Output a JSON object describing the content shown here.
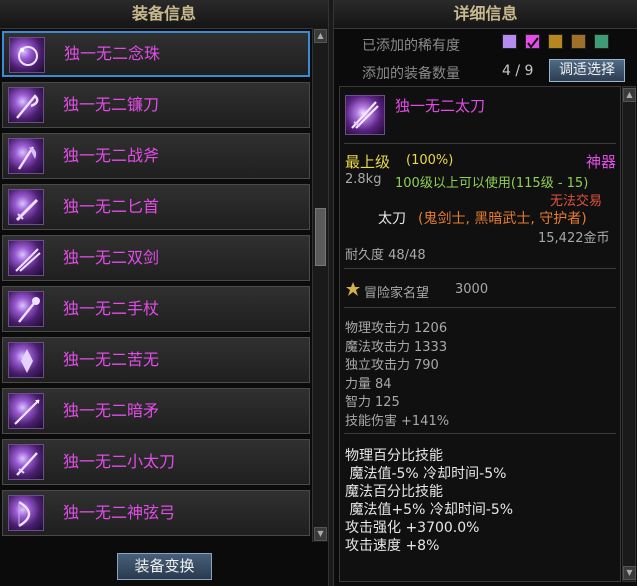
{
  "left_panel": {
    "title": "装备信息",
    "items": [
      {
        "label": "独一无二念珠"
      },
      {
        "label": "独一无二镰刀"
      },
      {
        "label": "独一无二战斧"
      },
      {
        "label": "独一无二匕首"
      },
      {
        "label": "独一无二双剑"
      },
      {
        "label": "独一无二手杖"
      },
      {
        "label": "独一无二苦无"
      },
      {
        "label": "独一无二暗矛"
      },
      {
        "label": "独一无二小太刀"
      },
      {
        "label": "独一无二神弦弓"
      }
    ],
    "swap_button": "装备变换"
  },
  "right_panel": {
    "title": "详细信息",
    "rarity_label": "已添加的稀有度",
    "rarity_swatches": [
      {
        "color": "#b48cf0",
        "checked": false
      },
      {
        "color": "#e14de6",
        "checked": true
      },
      {
        "color": "#b8861e",
        "checked": false
      },
      {
        "color": "#a0702a",
        "checked": false
      },
      {
        "color": "#3f9a78",
        "checked": false
      }
    ],
    "count_label": "添加的装备数量",
    "count_value": "4 / 9",
    "adjust_button": "调适选择",
    "item": {
      "name": "独一无二太刀",
      "grade": "最上级",
      "grade_percent": "(100%)",
      "rarity": "神器",
      "weight": "2.8kg",
      "level_req": "100级以上可以使用(115级 - 15)",
      "trade": "无法交易",
      "type_prefix": "太刀",
      "classes": "(鬼剑士, 黑暗武士, 守护者)",
      "price": "15,422金币",
      "durability": "耐久度 48/48",
      "reputation_label": "冒险家名望",
      "reputation_value": "3000",
      "stats": [
        {
          "name": "物理攻击力",
          "value": "1206"
        },
        {
          "name": "魔法攻击力",
          "value": "1333"
        },
        {
          "name": "独立攻击力",
          "value": "790"
        },
        {
          "name": "力量",
          "value": "84"
        },
        {
          "name": "智力",
          "value": "125"
        },
        {
          "name": "技能伤害",
          "value": "+141%"
        }
      ],
      "effects": [
        "物理百分比技能",
        " 魔法值-5% 冷却时间-5%",
        "魔法百分比技能",
        " 魔法值+5% 冷却时间-5%",
        "攻击强化 +3700.0%",
        "攻击速度 +8%"
      ]
    }
  }
}
